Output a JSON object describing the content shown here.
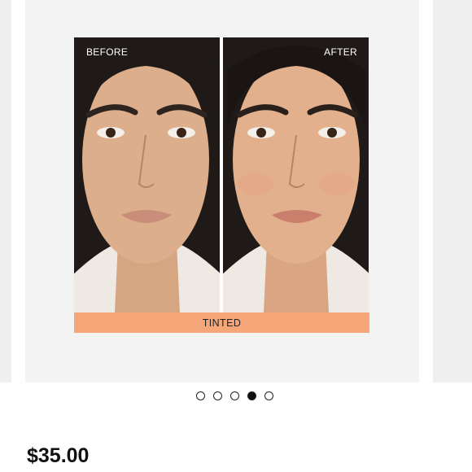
{
  "carousel": {
    "before_label": "BEFORE",
    "after_label": "AFTER",
    "banner_label": "TINTED",
    "banner_color": "#f5a77a",
    "slide_count": 5,
    "active_slide_index": 3
  },
  "product": {
    "price": "$35.00"
  }
}
